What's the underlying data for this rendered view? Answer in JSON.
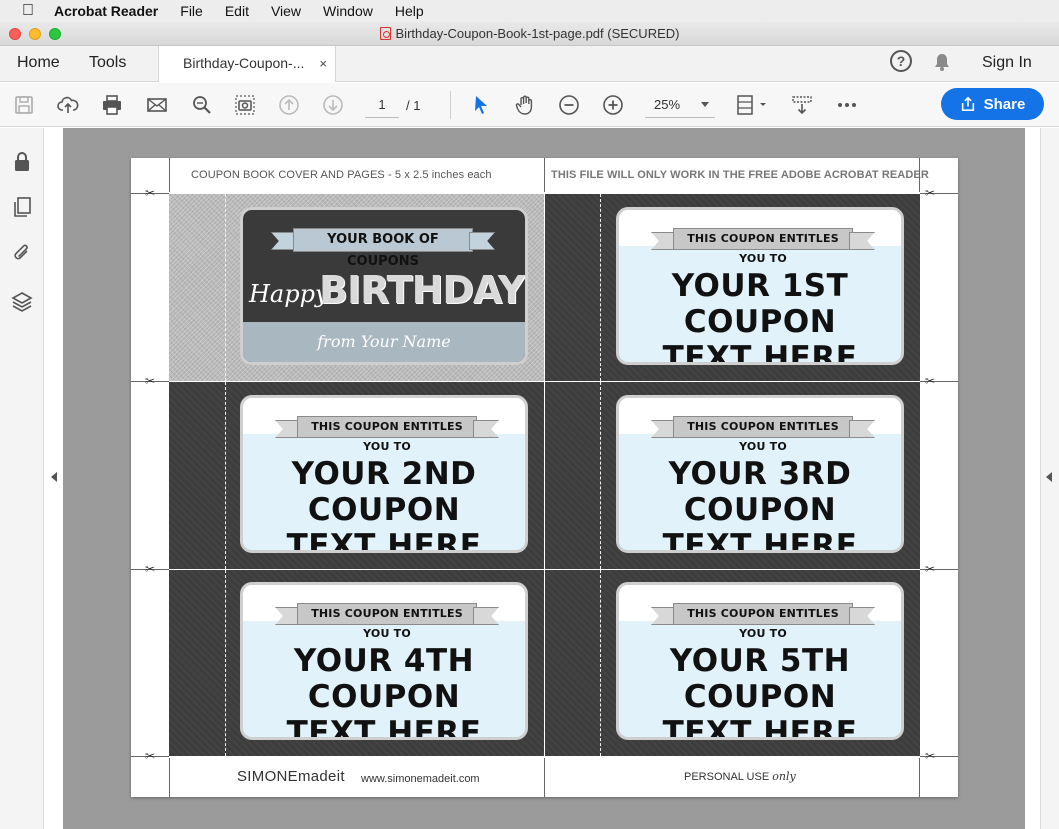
{
  "menubar": {
    "app": "Acrobat Reader",
    "items": [
      "File",
      "Edit",
      "View",
      "Window",
      "Help"
    ]
  },
  "window": {
    "title": "Birthday-Coupon-Book-1st-page.pdf (SECURED)"
  },
  "tabs": {
    "home": "Home",
    "tools": "Tools",
    "document": "Birthday-Coupon-...",
    "close": "×"
  },
  "header_right": {
    "help": "?",
    "sign_in": "Sign In"
  },
  "toolbar": {
    "page_current": "1",
    "page_total": "/ 1",
    "zoom": "25%",
    "share_label": "Share"
  },
  "colors": {
    "accent": "#1473e6",
    "chalkboard": "#3d3d3d",
    "coupon_fill": "#e1f2fb"
  },
  "icons": {
    "toolbar": [
      "save-icon",
      "upload-icon",
      "print-icon",
      "email-icon",
      "zoom-search-icon",
      "snapshot-icon",
      "page-up-icon",
      "page-down-icon",
      "select-arrow-icon",
      "hand-icon",
      "zoom-out-icon",
      "zoom-in-icon",
      "fit-page-icon",
      "scan-icon",
      "more-icon"
    ],
    "rail": [
      "lock-icon",
      "pages-icon",
      "attachment-icon",
      "layers-icon"
    ]
  },
  "document": {
    "header_left": "COUPON BOOK COVER AND PAGES - 5 x 2.5 inches each",
    "header_right": "THIS FILE WILL ONLY WORK IN THE FREE ADOBE ACROBAT READER",
    "cover": {
      "banner": "YOUR BOOK OF COUPONS",
      "happy": "Happy",
      "birthday": "BIRTHDAY",
      "from": "from Your Name"
    },
    "coupons": [
      {
        "banner": "THIS COUPON ENTITLES YOU TO",
        "line1": "YOUR 1ST COUPON",
        "line2": "TEXT HERE"
      },
      {
        "banner": "THIS COUPON ENTITLES YOU TO",
        "line1": "YOUR 2ND COUPON",
        "line2": "TEXT HERE"
      },
      {
        "banner": "THIS COUPON ENTITLES YOU TO",
        "line1": "YOUR 3RD COUPON",
        "line2": "TEXT HERE"
      },
      {
        "banner": "THIS COUPON ENTITLES YOU TO",
        "line1": "YOUR 4TH COUPON",
        "line2": "TEXT HERE"
      },
      {
        "banner": "THIS COUPON ENTITLES YOU TO",
        "line1": "YOUR 5TH COUPON",
        "line2": "TEXT HERE"
      }
    ],
    "footer": {
      "brand": "SIMONEmadeit",
      "url": "www.simonemadeit.com",
      "personal_use": "PERSONAL USE",
      "only": "only"
    }
  }
}
